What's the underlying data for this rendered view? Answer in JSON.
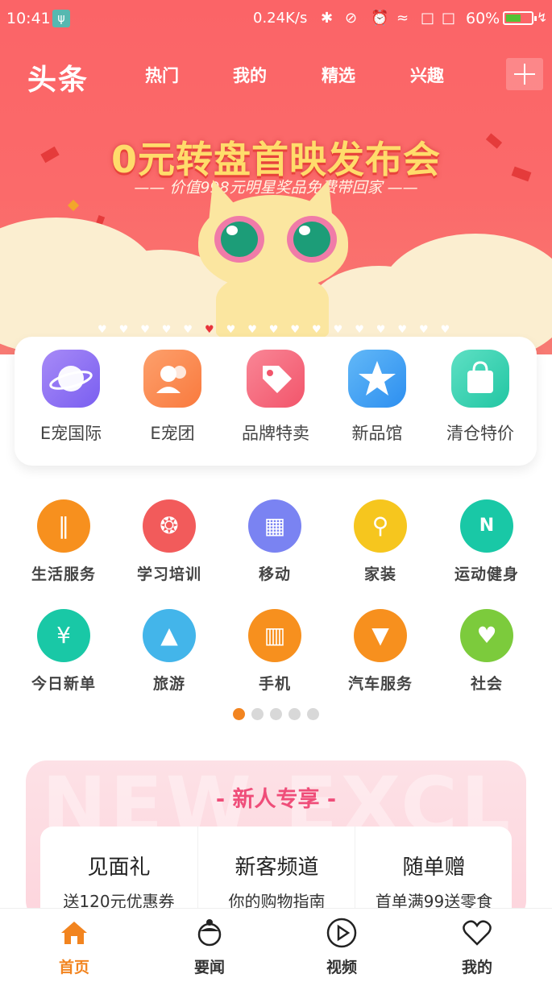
{
  "status_bar": {
    "time": "10:41",
    "usb_icon": "usb-icon",
    "speed": "0.24K/s",
    "battery_pct": "60%",
    "battery_level": 0.6
  },
  "header": {
    "logo": "头条",
    "tabs": [
      "热门",
      "我的",
      "精选",
      "兴趣"
    ],
    "add_icon": "plus-icon"
  },
  "banner": {
    "title": "0元转盘首映发布会",
    "subtitle": "—— 价值998元明星奖品免费带回家 ——",
    "slide_count": 17,
    "active_slide": 5
  },
  "features": [
    {
      "label": "E宠国际",
      "icon": "planet-icon",
      "color": "#8f72f0"
    },
    {
      "label": "E宠团",
      "icon": "people-icon",
      "color": "#fb8a52"
    },
    {
      "label": "品牌特卖",
      "icon": "tag-icon",
      "color": "#f5677a"
    },
    {
      "label": "新品馆",
      "icon": "star-icon",
      "color": "#3ea2f2"
    },
    {
      "label": "清仓特价",
      "icon": "shopping-bag-icon",
      "color": "#2fcfae"
    }
  ],
  "categories": [
    {
      "label": "生活服务",
      "icon": "cutlery-icon",
      "color": "#f7901e"
    },
    {
      "label": "学习培训",
      "icon": "film-reel-icon",
      "color": "#f25b5b"
    },
    {
      "label": "移动",
      "icon": "building-icon",
      "color": "#7a83f2"
    },
    {
      "label": "家装",
      "icon": "microphone-icon",
      "color": "#f6c61e"
    },
    {
      "label": "运动健身",
      "icon": "tag-n-icon",
      "color": "#19c8a6"
    },
    {
      "label": "今日新单",
      "icon": "ticket-yen-icon",
      "color": "#19c8a6"
    },
    {
      "label": "旅游",
      "icon": "landscape-icon",
      "color": "#43b5ea"
    },
    {
      "label": "手机",
      "icon": "fries-icon",
      "color": "#f7901e"
    },
    {
      "label": "汽车服务",
      "icon": "ice-cream-icon",
      "color": "#f7901e"
    },
    {
      "label": "社会",
      "icon": "heart-hands-icon",
      "color": "#7ccb3c"
    }
  ],
  "pager": {
    "count": 5,
    "active": 0
  },
  "new_user": {
    "ghost_text": "NEW EXCL",
    "title": "- 新人专享 -",
    "items": [
      {
        "title": "见面礼",
        "sub": "送120元优惠券"
      },
      {
        "title": "新客频道",
        "sub": "你的购物指南"
      },
      {
        "title": "随单赠",
        "sub": "首单满99送零食"
      }
    ]
  },
  "tabbar": [
    {
      "label": "首页",
      "icon": "home-icon",
      "active": true
    },
    {
      "label": "要闻",
      "icon": "person-icon",
      "active": false
    },
    {
      "label": "视频",
      "icon": "play-icon",
      "active": false
    },
    {
      "label": "我的",
      "icon": "heart-icon",
      "active": false
    }
  ],
  "colors": {
    "header_red": "#fb6467",
    "accent_orange": "#f2841f",
    "new_title_pink": "#ef4d79"
  }
}
